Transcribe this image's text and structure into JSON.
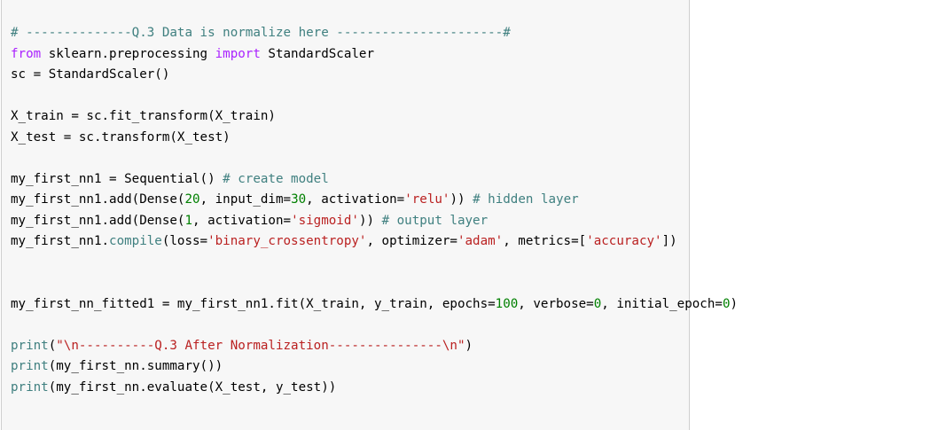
{
  "colors": {
    "comment": "#408080",
    "keyword": "#aa22ff",
    "string": "#ba2121",
    "number": "#008000",
    "plain": "#000000",
    "cell_background": "#f7f7f7",
    "cell_border": "#cfcfcf"
  },
  "code_lines": [
    [
      {
        "t": "comment",
        "v": "# --------------Q.3 Data is normalize here ----------------------#"
      }
    ],
    [
      {
        "t": "keyword",
        "v": "from"
      },
      {
        "t": "plain",
        "v": " sklearn.preprocessing "
      },
      {
        "t": "keyword",
        "v": "import"
      },
      {
        "t": "plain",
        "v": " StandardScaler"
      }
    ],
    [
      {
        "t": "plain",
        "v": "sc = StandardScaler()"
      }
    ],
    [],
    [
      {
        "t": "plain",
        "v": "X_train = sc.fit_transform(X_train)"
      }
    ],
    [
      {
        "t": "plain",
        "v": "X_test = sc.transform(X_test)"
      }
    ],
    [],
    [
      {
        "t": "plain",
        "v": "my_first_nn1 = Sequential() "
      },
      {
        "t": "comment",
        "v": "# create model"
      }
    ],
    [
      {
        "t": "plain",
        "v": "my_first_nn1.add(Dense("
      },
      {
        "t": "number",
        "v": "20"
      },
      {
        "t": "plain",
        "v": ", input_dim="
      },
      {
        "t": "number",
        "v": "30"
      },
      {
        "t": "plain",
        "v": ", activation="
      },
      {
        "t": "string",
        "v": "'relu'"
      },
      {
        "t": "plain",
        "v": ")) "
      },
      {
        "t": "comment",
        "v": "# hidden layer"
      }
    ],
    [
      {
        "t": "plain",
        "v": "my_first_nn1.add(Dense("
      },
      {
        "t": "number",
        "v": "1"
      },
      {
        "t": "plain",
        "v": ", activation="
      },
      {
        "t": "string",
        "v": "'sigmoid'"
      },
      {
        "t": "plain",
        "v": ")) "
      },
      {
        "t": "comment",
        "v": "# output layer"
      }
    ],
    [
      {
        "t": "plain",
        "v": "my_first_nn1."
      },
      {
        "t": "comment",
        "v": "compile"
      },
      {
        "t": "plain",
        "v": "(loss="
      },
      {
        "t": "string",
        "v": "'binary_crossentropy'"
      },
      {
        "t": "plain",
        "v": ", optimizer="
      },
      {
        "t": "string",
        "v": "'adam'"
      },
      {
        "t": "plain",
        "v": ", metrics=["
      },
      {
        "t": "string",
        "v": "'accuracy'"
      },
      {
        "t": "plain",
        "v": "])"
      }
    ],
    [],
    [],
    [
      {
        "t": "plain",
        "v": "my_first_nn_fitted1 = my_first_nn1.fit(X_train, y_train, epochs="
      },
      {
        "t": "number",
        "v": "100"
      },
      {
        "t": "plain",
        "v": ", verbose="
      },
      {
        "t": "number",
        "v": "0"
      },
      {
        "t": "plain",
        "v": ", initial_epoch="
      },
      {
        "t": "number",
        "v": "0"
      },
      {
        "t": "plain",
        "v": ")"
      }
    ],
    [],
    [
      {
        "t": "comment",
        "v": "print"
      },
      {
        "t": "plain",
        "v": "("
      },
      {
        "t": "string",
        "v": "\"\\n----------Q.3 After Normalization---------------\\n\""
      },
      {
        "t": "plain",
        "v": ")"
      }
    ],
    [
      {
        "t": "comment",
        "v": "print"
      },
      {
        "t": "plain",
        "v": "(my_first_nn.summary())"
      }
    ],
    [
      {
        "t": "comment",
        "v": "print"
      },
      {
        "t": "plain",
        "v": "(my_first_nn.evaluate(X_test, y_test))"
      }
    ]
  ]
}
